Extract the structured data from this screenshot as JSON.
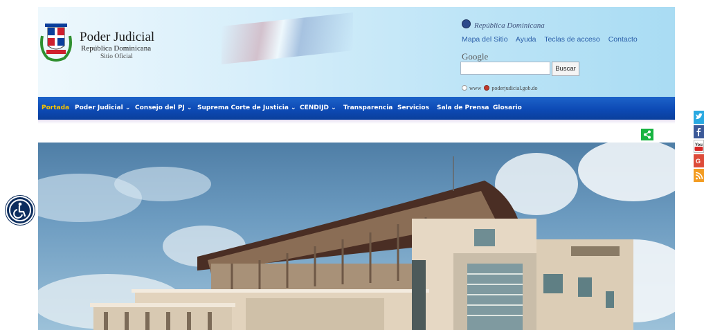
{
  "header": {
    "title": "Poder Judicial",
    "subtitle": "República Dominicana",
    "tagline": "Sitio Oficial",
    "republica": "República Dominicana",
    "links": [
      "Mapa del Sitio",
      "Ayuda",
      "Teclas de acceso",
      "Contacto"
    ],
    "google": "Google",
    "search_placeholder": "",
    "search_button": "Buscar",
    "radio_www": "www",
    "radio_site": "poderjudicial.gob.do"
  },
  "nav": {
    "items": [
      "Portada",
      "Poder Judicial",
      "Consejo del PJ",
      "Suprema Corte de Justicia",
      "CENDIJD",
      "Transparencia",
      "Servicios",
      "Sala de Prensa",
      "Glosario"
    ],
    "active_index": 0,
    "has_dropdown": [
      false,
      true,
      true,
      true,
      true,
      false,
      false,
      false,
      false
    ]
  },
  "social": [
    "twitter-icon",
    "facebook-icon",
    "youtube-icon",
    "google-plus-icon",
    "rss-icon"
  ],
  "colors": {
    "nav_bg": "#0d4ab5",
    "nav_active": "#f6c400",
    "share": "#18b441",
    "accessibility": "#0c2d5e"
  }
}
